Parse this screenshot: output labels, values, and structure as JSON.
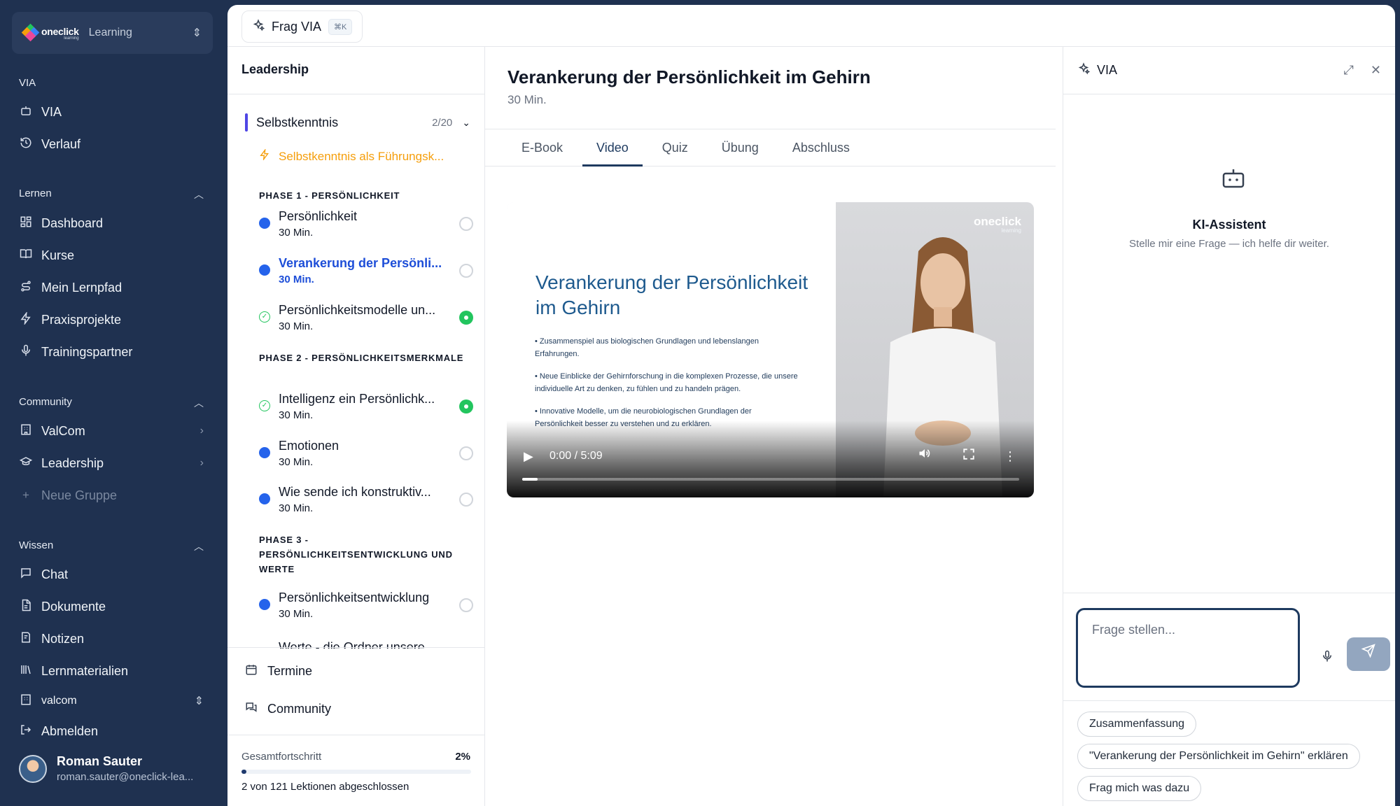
{
  "app": {
    "logo_text": "oneclick",
    "logo_sub": "learning",
    "name": "Learning"
  },
  "sidebar": {
    "via_section": "VIA",
    "via_items": [
      {
        "label": "VIA",
        "icon": "robot-icon"
      },
      {
        "label": "Verlauf",
        "icon": "history-icon"
      }
    ],
    "lernen_section": "Lernen",
    "lernen_items": [
      {
        "label": "Dashboard",
        "icon": "dashboard-icon"
      },
      {
        "label": "Kurse",
        "icon": "book-icon"
      },
      {
        "label": "Mein Lernpfad",
        "icon": "route-icon"
      },
      {
        "label": "Praxisprojekte",
        "icon": "bolt-icon"
      },
      {
        "label": "Trainingspartner",
        "icon": "mic-icon"
      }
    ],
    "community_section": "Community",
    "community_items": [
      {
        "label": "ValCom",
        "icon": "building-icon"
      },
      {
        "label": "Leadership",
        "icon": "graduation-icon"
      },
      {
        "label": "Neue Gruppe",
        "icon": "plus-icon"
      }
    ],
    "wissen_section": "Wissen",
    "wissen_items": [
      {
        "label": "Chat",
        "icon": "chat-icon"
      },
      {
        "label": "Dokumente",
        "icon": "document-icon"
      },
      {
        "label": "Notizen",
        "icon": "notes-icon"
      },
      {
        "label": "Lernmaterialien",
        "icon": "library-icon"
      }
    ],
    "workspace": "valcom",
    "logout": "Abmelden",
    "user": {
      "name": "Roman Sauter",
      "email": "roman.sauter@oneclick-lea..."
    }
  },
  "topbar": {
    "frag_via": "Frag VIA",
    "shortcut": "⌘K"
  },
  "course": {
    "title": "Leadership",
    "chapter": {
      "name": "Selbstkenntnis",
      "count": "2/20"
    },
    "intro": "Selbstkenntnis als Führungsk...",
    "phases": [
      "PHASE 1 - PERSÖNLICHKEIT",
      "PHASE 2 - PERSÖNLICHKEITSMERKMALE",
      "PHASE 3 - PERSÖNLICHKEITSENTWICKLUNG UND WERTE"
    ],
    "lessons": [
      {
        "title": "Persönlichkeit",
        "duration": "30 Min."
      },
      {
        "title": "Verankerung der Persönli...",
        "duration": "30 Min."
      },
      {
        "title": "Persönlichkeitsmodelle un...",
        "duration": "30 Min."
      },
      {
        "title": "Intelligenz ein Persönlichk...",
        "duration": "30 Min."
      },
      {
        "title": "Emotionen",
        "duration": "30 Min."
      },
      {
        "title": "Wie sende ich konstruktiv...",
        "duration": "30 Min."
      },
      {
        "title": "Persönlichkeitsentwicklung",
        "duration": "30 Min."
      },
      {
        "title": "Werte - die Ordner unsere",
        "duration": ""
      }
    ],
    "links": {
      "termine": "Termine",
      "community": "Community"
    },
    "progress": {
      "label": "Gesamtfortschritt",
      "percent": "2%",
      "value": 0.02,
      "text": "2 von 121 Lektionen abgeschlossen"
    }
  },
  "content": {
    "title": "Verankerung der Persönlichkeit im Gehirn",
    "duration": "30 Min.",
    "tabs": [
      "E-Book",
      "Video",
      "Quiz",
      "Übung",
      "Abschluss"
    ],
    "active_tab": "Video",
    "video": {
      "slide_title": "Verankerung der Persönlichkeit im Gehirn",
      "bullets": [
        "• Zusammenspiel aus biologischen Grundlagen und lebenslangen Erfahrungen.",
        "• Neue Einblicke der Gehirnforschung in die komplexen Prozesse, die unsere individuelle Art zu denken, zu fühlen und zu handeln prägen.",
        "• Innovative Modelle, um die neurobiologischen Grundlagen der Persönlichkeit besser zu verstehen und zu erklären."
      ],
      "brand": "oneclick",
      "brand_sub": "learning",
      "time": "0:00 / 5:09"
    }
  },
  "via_panel": {
    "title": "VIA",
    "assistant_title": "KI-Assistent",
    "assistant_sub": "Stelle mir eine Frage — ich helfe dir weiter.",
    "input_placeholder": "Frage stellen...",
    "suggestions": [
      "Zusammenfassung",
      "\"Verankerung der Persönlichkeit im Gehirn\" erklären",
      "Frag mich was dazu"
    ]
  },
  "colors": {
    "sidebar_bg": "#1f3150",
    "accent": "#1e3a5f",
    "active_lesson": "#1d4ed8",
    "success": "#22c55e",
    "intro": "#f59e0b"
  }
}
